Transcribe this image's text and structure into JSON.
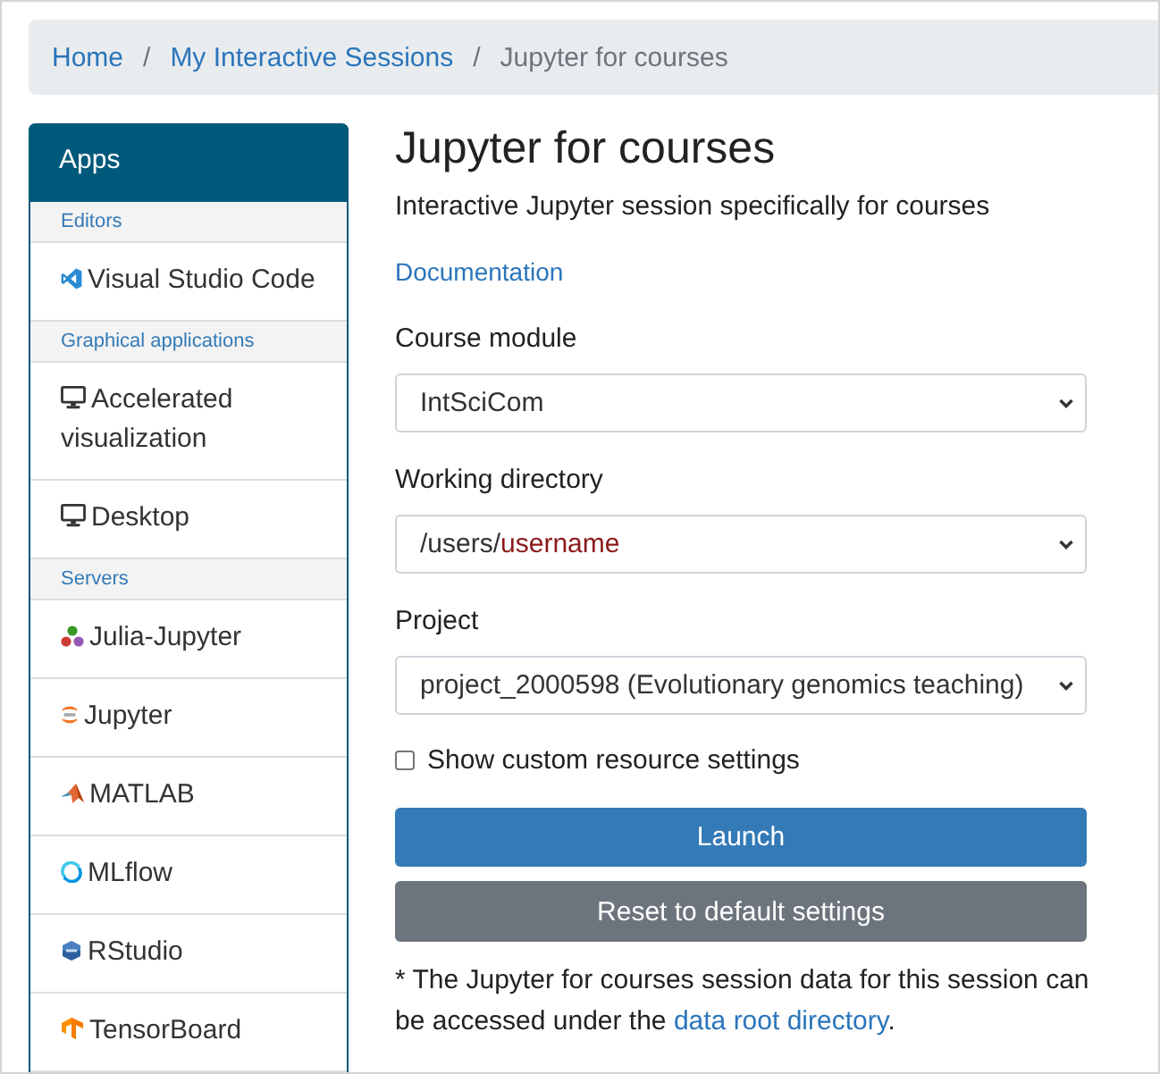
{
  "breadcrumb": [
    {
      "label": "Home",
      "kind": "link"
    },
    {
      "label": "/",
      "kind": "separator"
    },
    {
      "label": "My Interactive Sessions",
      "kind": "link"
    },
    {
      "label": "/",
      "kind": "separator"
    },
    {
      "label": "Jupyter for courses",
      "kind": "current"
    }
  ],
  "sidebar": {
    "title": "Apps",
    "groups": [
      {
        "heading": "Editors",
        "items": [
          {
            "label": "Visual Studio Code",
            "kind": "vscode"
          }
        ]
      },
      {
        "heading": "Graphical applications",
        "items": [
          {
            "label": "Accelerated visualization",
            "kind": "monitor"
          },
          {
            "label": "Desktop",
            "kind": "monitor"
          }
        ]
      },
      {
        "heading": "Servers",
        "items": [
          {
            "label": "Julia-Jupyter",
            "kind": "julia"
          },
          {
            "label": "Jupyter",
            "kind": "jupyter"
          },
          {
            "label": "MATLAB",
            "kind": "matlab"
          },
          {
            "label": "MLflow",
            "kind": "mlflow"
          },
          {
            "label": "RStudio",
            "kind": "rstudio"
          },
          {
            "label": "TensorBoard",
            "kind": "tensorboard"
          }
        ]
      }
    ]
  },
  "form": {
    "title": "Jupyter for courses",
    "description": "Interactive Jupyter session specifically for courses",
    "documentation_link": "Documentation",
    "fields": [
      {
        "label": "Course module",
        "kind": "select",
        "value_parts": [
          {
            "text": "IntSciCom",
            "kind": "plain"
          }
        ]
      },
      {
        "label": "Working directory",
        "kind": "select",
        "value_parts": [
          {
            "text": "/users/",
            "kind": "plain"
          },
          {
            "text": "username",
            "kind": "variable"
          }
        ]
      },
      {
        "label": "Project",
        "kind": "select",
        "value_parts": [
          {
            "text": "project_2000598 (Evolutionary genomics teaching)",
            "kind": "plain"
          }
        ]
      },
      {
        "label": "Show custom resource settings",
        "kind": "checkbox",
        "checked": false
      }
    ],
    "buttons": [
      {
        "label": "Launch",
        "kind": "primary"
      },
      {
        "label": "Reset to default settings",
        "kind": "secondary"
      }
    ],
    "footnote": {
      "text": "* The Jupyter for courses session data for this session can be accessed under the ",
      "link": "data root directory",
      "after": "."
    }
  }
}
